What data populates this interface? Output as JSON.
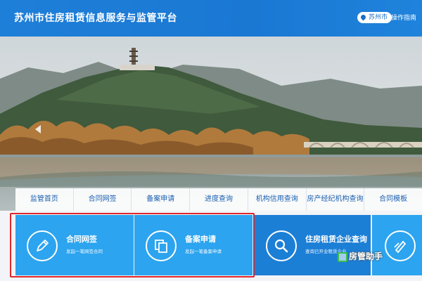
{
  "header": {
    "title": "苏州市住房租赁信息服务与监管平台",
    "city_label": "苏州市",
    "guide_label": "操作指南",
    "accent_color": "#1a78d3"
  },
  "banner": {
    "prev_icon": "chevron-left-icon"
  },
  "nav": {
    "items": [
      {
        "label": "监管首页"
      },
      {
        "label": "合同网签"
      },
      {
        "label": "备案申请"
      },
      {
        "label": "进度查询"
      },
      {
        "label": "机构信用查询"
      },
      {
        "label": "房产经纪机构查询"
      },
      {
        "label": "合同模板"
      }
    ]
  },
  "cards": [
    {
      "title": "合同网签",
      "desc": "发起一笔网签合同",
      "icon": "pencil-icon",
      "color": "#2ca4ef"
    },
    {
      "title": "备案申请",
      "desc": "发起一笔备案申请",
      "icon": "copy-document-icon",
      "color": "#2ca4ef"
    },
    {
      "title": "住房租赁企业查询",
      "desc": "查询已开业租赁企业",
      "icon": "magnifier-icon",
      "color": "#1c7fd6"
    },
    {
      "title": "",
      "desc": "",
      "icon": "contract-icon",
      "color": "#2ca4ef"
    }
  ],
  "highlight_color": "#e0262b",
  "watermark": {
    "text": "房管助手",
    "icon": "watermark-logo-icon"
  }
}
